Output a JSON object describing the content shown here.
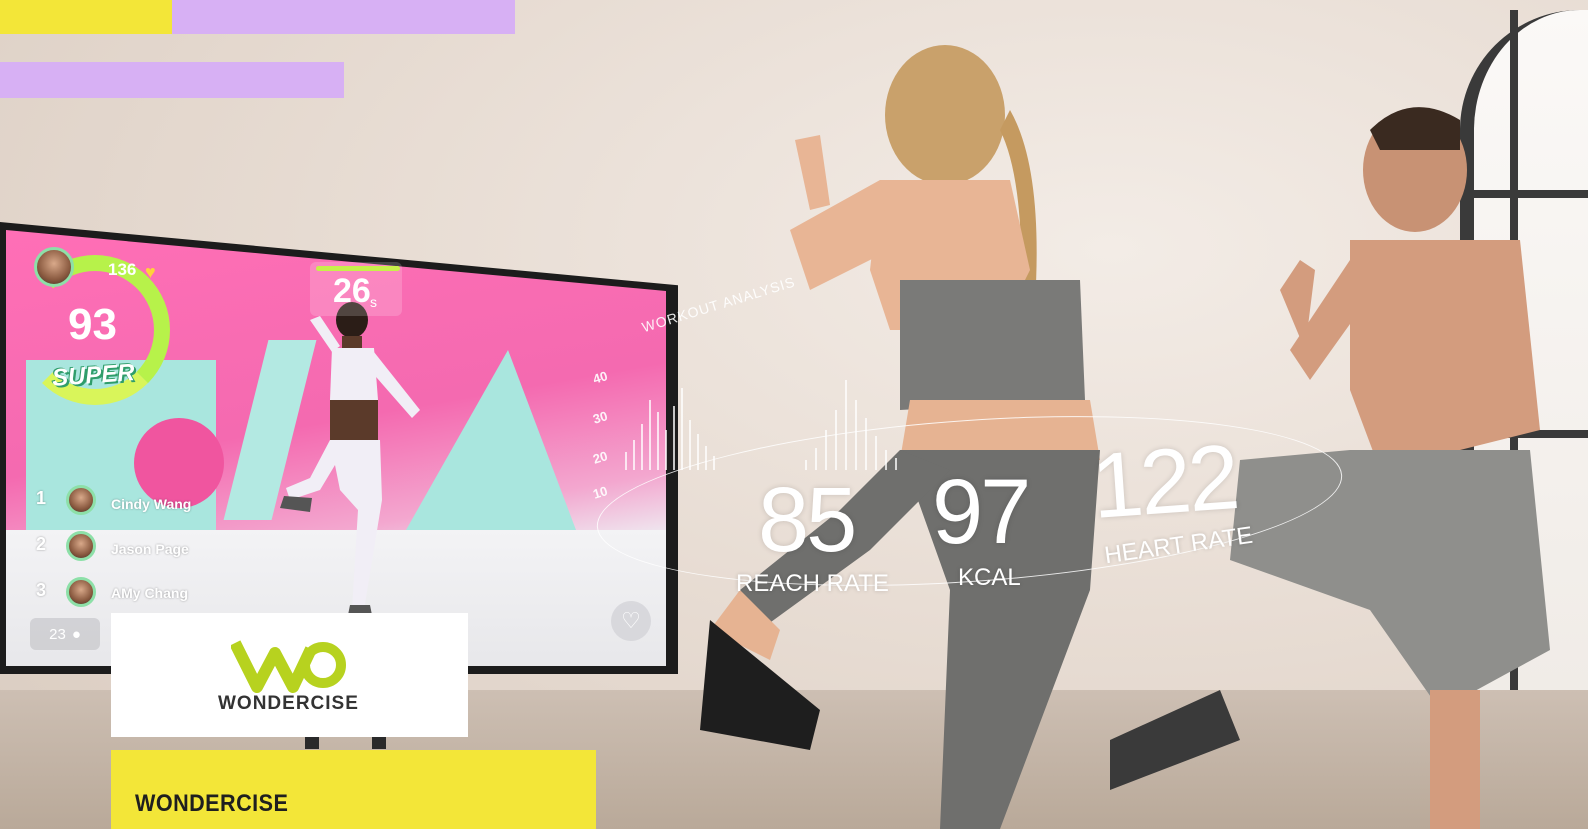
{
  "colors": {
    "accent_yellow": "#f3e638",
    "accent_lilac": "#d7b0f4",
    "screen_pink": "#f46ab0",
    "score_green": "#b7f24a"
  },
  "tv_screen": {
    "score": "93",
    "rating": "SUPER",
    "hearts": "136",
    "timer": "26",
    "timer_unit": "s",
    "leaderboard": [
      {
        "rank": "1",
        "name": "Cindy Wang"
      },
      {
        "rank": "2",
        "name": "Jason Page"
      },
      {
        "rank": "3",
        "name": "AMy Chang"
      }
    ],
    "participants": "23",
    "icons": {
      "heart": "heart-icon",
      "user": "user-icon",
      "like": "like-icon"
    }
  },
  "analysis": {
    "title": "WORKOUT ANALYSIS",
    "axis_ticks": [
      "40",
      "30",
      "20",
      "10"
    ],
    "stats": [
      {
        "value": "85",
        "label": "REACH RATE"
      },
      {
        "value": "97",
        "label": "KCAL"
      },
      {
        "value": "122",
        "label": "HEART RATE"
      }
    ]
  },
  "brand": {
    "logo_text": "WONDERCISE",
    "caption": "WONDERCISE"
  }
}
